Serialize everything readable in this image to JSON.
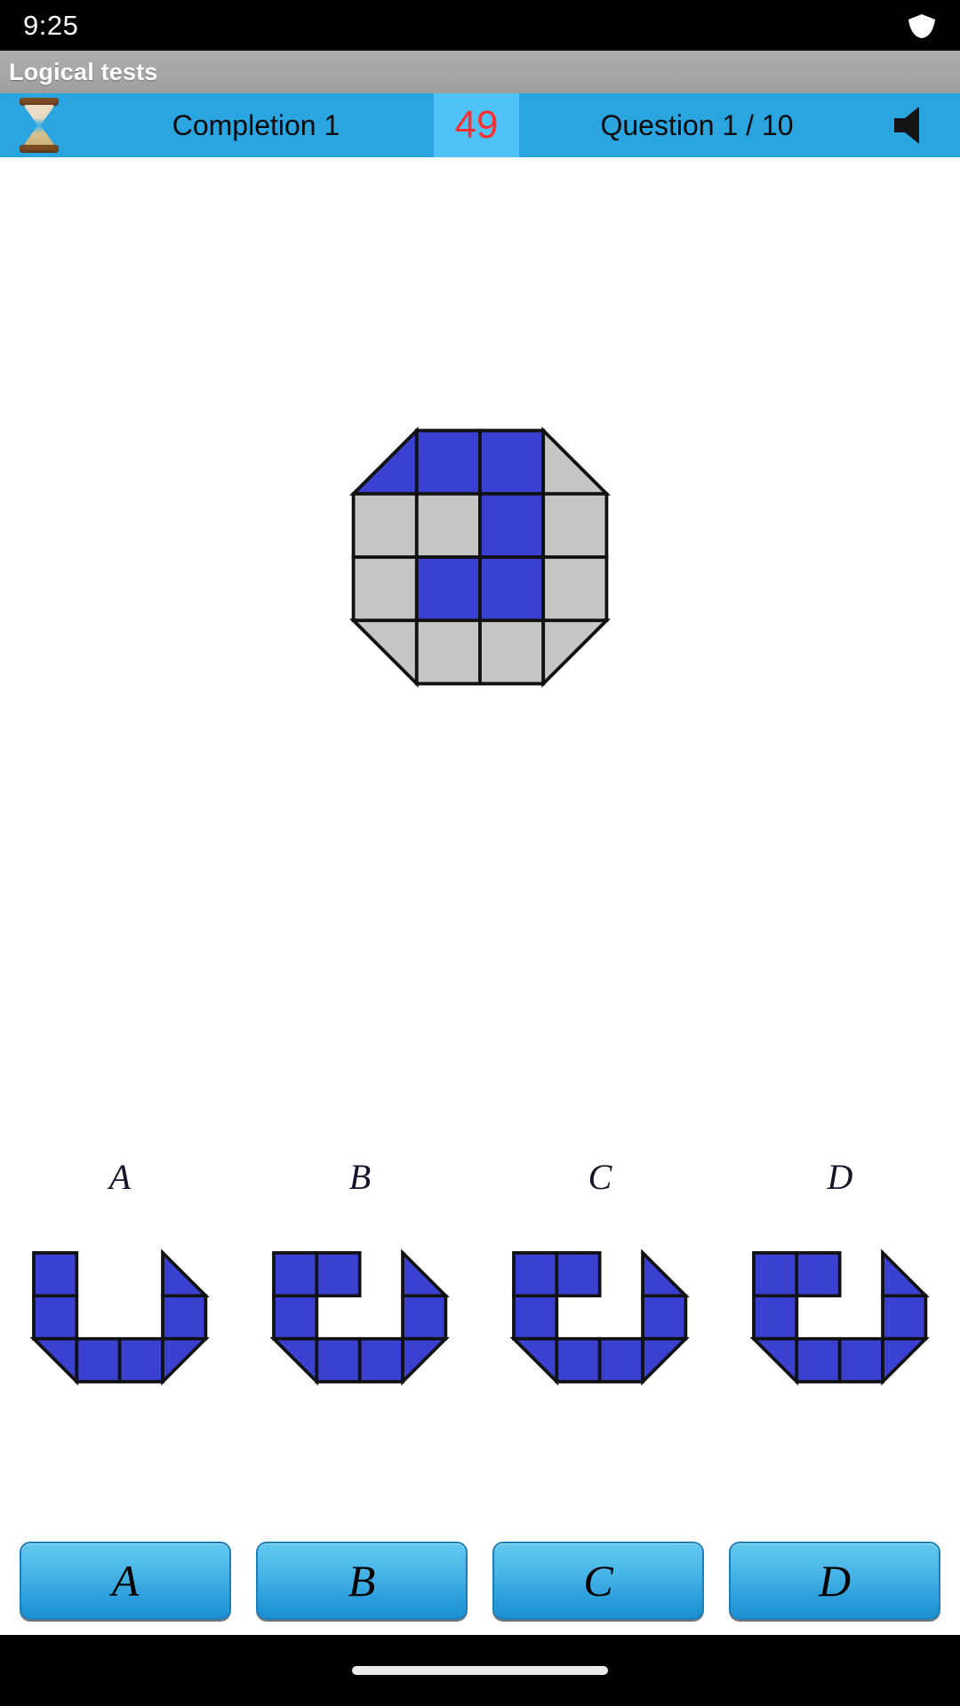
{
  "status_bar": {
    "clock": "9:25",
    "icons": [
      "wifi-icon"
    ]
  },
  "app_bar": {
    "title": "Logical tests"
  },
  "info_bar": {
    "hourglass_icon": "hourglass-icon",
    "completion_label": "Completion 1",
    "timer_value": "49",
    "question_label": "Question 1 / 10",
    "speaker_icon": "speaker-icon",
    "bar_color": "#2aa5e0",
    "timer_cell_color": "#4fc3f7",
    "timer_text_color": "#ff2f2f"
  },
  "colors": {
    "blue": "#3a40cf",
    "gray": "#c6c6c6",
    "stroke": "#111111"
  },
  "chart_data": {
    "type": "table",
    "title": "Logical test question figure",
    "prompt_figure": {
      "name": "octagon-grid",
      "grid": 4,
      "cut_corners": [
        "top-left",
        "top-right",
        "bottom-left",
        "bottom-right"
      ],
      "cells": [
        [
          "blue",
          "blue",
          "blue",
          "gray"
        ],
        [
          "gray",
          "gray",
          "blue",
          "gray"
        ],
        [
          "gray",
          "blue",
          "blue",
          "gray"
        ],
        [
          "gray",
          "gray",
          "gray",
          "gray"
        ]
      ]
    },
    "options": [
      {
        "label": "A",
        "cells": [
          [
            "blue",
            "none",
            "none",
            "blue"
          ],
          [
            "blue",
            "none",
            "none",
            "blue"
          ],
          [
            "blue",
            "blue",
            "blue",
            "blue"
          ]
        ],
        "corner_cuts": [
          {
            "row": 0,
            "col": 3,
            "corner": "top-right"
          },
          {
            "row": 2,
            "col": 0,
            "corner": "bottom-left"
          },
          {
            "row": 2,
            "col": 3,
            "corner": "bottom-right"
          }
        ]
      },
      {
        "label": "B",
        "cells": [
          [
            "blue",
            "blue",
            "none",
            "blue"
          ],
          [
            "blue",
            "none",
            "none",
            "blue"
          ],
          [
            "blue",
            "blue",
            "blue",
            "blue"
          ]
        ],
        "corner_cuts": [
          {
            "row": 0,
            "col": 3,
            "corner": "top-right"
          },
          {
            "row": 2,
            "col": 0,
            "corner": "bottom-left"
          },
          {
            "row": 2,
            "col": 3,
            "corner": "bottom-right"
          }
        ]
      },
      {
        "label": "C",
        "cells": [
          [
            "blue",
            "blue",
            "none",
            "blue"
          ],
          [
            "blue",
            "none",
            "none",
            "blue"
          ],
          [
            "blue",
            "blue",
            "blue",
            "blue"
          ]
        ],
        "corner_cuts": [
          {
            "row": 0,
            "col": 3,
            "corner": "top-right"
          },
          {
            "row": 2,
            "col": 0,
            "corner": "bottom-left"
          },
          {
            "row": 2,
            "col": 3,
            "corner": "bottom-right"
          }
        ]
      },
      {
        "label": "D",
        "cells": [
          [
            "blue",
            "blue",
            "none",
            "blue"
          ],
          [
            "blue",
            "none",
            "none",
            "blue"
          ],
          [
            "blue",
            "blue",
            "blue",
            "blue"
          ]
        ],
        "corner_cuts": [
          {
            "row": 0,
            "col": 3,
            "corner": "top-right"
          },
          {
            "row": 2,
            "col": 0,
            "corner": "bottom-left"
          },
          {
            "row": 2,
            "col": 3,
            "corner": "bottom-right"
          }
        ]
      }
    ]
  },
  "options_labels": {
    "a": "A",
    "b": "B",
    "c": "C",
    "d": "D"
  },
  "answer_buttons": {
    "a": "A",
    "b": "B",
    "c": "C",
    "d": "D"
  }
}
